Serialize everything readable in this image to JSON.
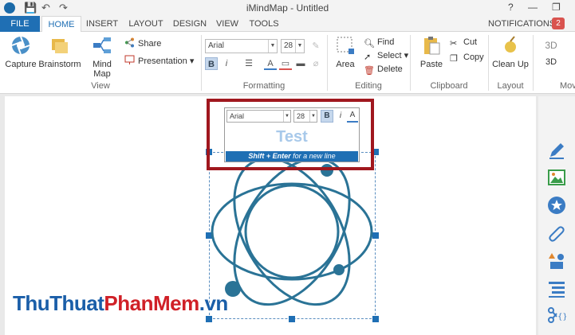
{
  "window": {
    "title": "iMindMap - Untitled",
    "help": "?",
    "minimize": "—",
    "restore": "❐"
  },
  "tabs": [
    "FILE",
    "HOME",
    "INSERT",
    "LAYOUT",
    "DESIGN",
    "VIEW",
    "TOOLS"
  ],
  "notifications": {
    "label": "NOTIFICATIONS",
    "count": "2"
  },
  "ribbon": {
    "view": {
      "label": "View",
      "capture": "Capture",
      "brainstorm": "Brainstorm",
      "mindmap": "Mind Map",
      "share": "Share",
      "presentation": "Presentation"
    },
    "formatting": {
      "label": "Formatting",
      "font": "Arial",
      "size": "28"
    },
    "editing": {
      "label": "Editing",
      "area": "Area",
      "find": "Find",
      "select": "Select",
      "delete": "Delete"
    },
    "clipboard": {
      "label": "Clipboard",
      "paste": "Paste",
      "cut": "Cut",
      "copy": "Copy"
    },
    "layout": {
      "label": "Layout",
      "cleanup": "Clean Up"
    },
    "more": {
      "label": "Mov",
      "three_d": "3D"
    }
  },
  "editor": {
    "font": "Arial",
    "size": "28",
    "bold": "B",
    "italic": "i",
    "color": "A",
    "text": "Test",
    "hint_bold": "Shift + Enter",
    "hint_rest": " for a new line"
  },
  "watermark": {
    "part1": "ThuThuat",
    "part2": "PhanMem",
    "part3": ".vn"
  },
  "colors": {
    "accent": "#1f6fb4",
    "highlight": "#a0171e",
    "atom": "#2a7396"
  }
}
